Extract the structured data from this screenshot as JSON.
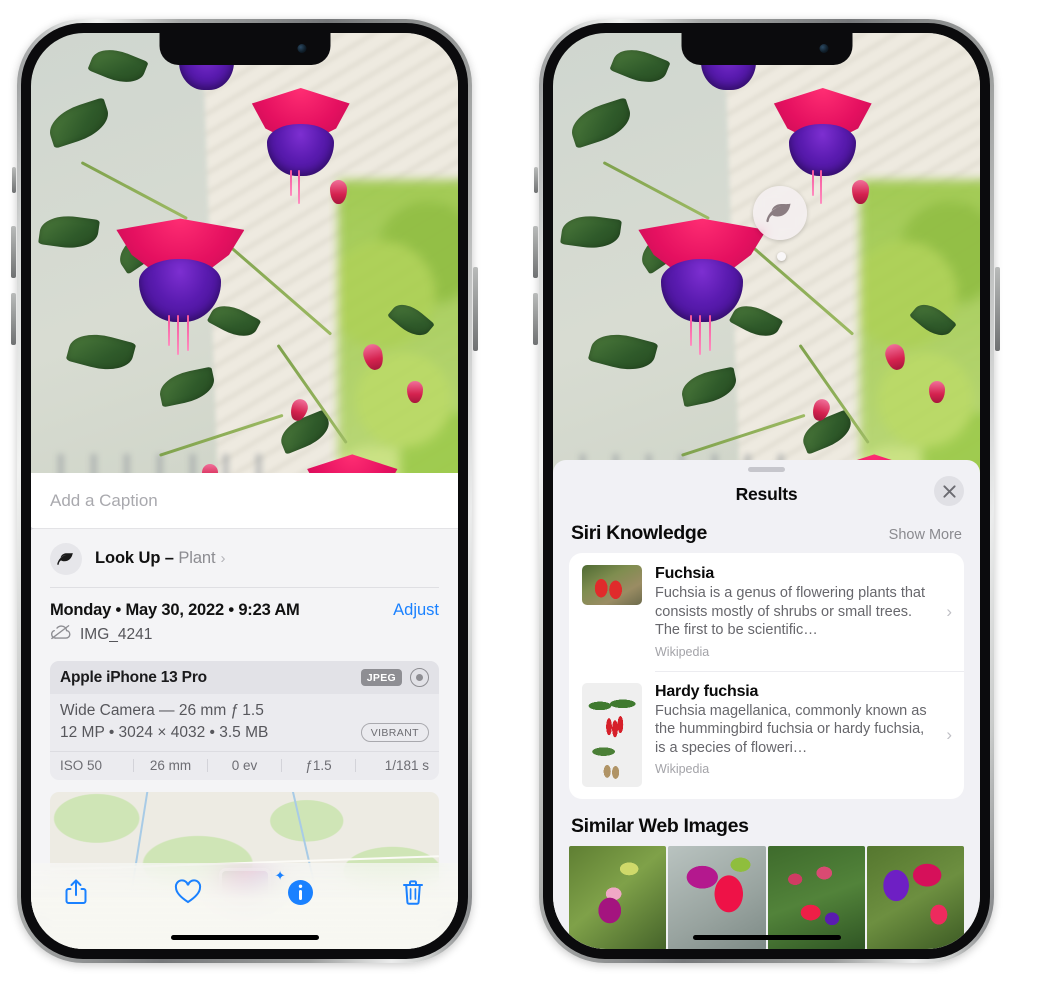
{
  "left_phone": {
    "caption_field": {
      "placeholder": "Add a Caption",
      "value": ""
    },
    "lookup": {
      "label": "Look Up – ",
      "subject": "Plant",
      "chevron": "›",
      "icon": "leaf-icon"
    },
    "metadata": {
      "date": "Monday • May 30, 2022 • 9:23 AM",
      "adjust_label": "Adjust",
      "filename": "IMG_4241",
      "cloud_icon": "cloud-slash-icon"
    },
    "camera_card": {
      "model": "Apple iPhone 13 Pro",
      "format_badge": "JPEG",
      "raw_icon": "raw-circle-icon",
      "lens_line": "Wide Camera — 26 mm ƒ 1.5",
      "size_line": "12 MP • 3024 × 4032 • 3.5 MB",
      "style_badge": "VIBRANT",
      "exif": [
        "ISO 50",
        "26 mm",
        "0 ev",
        "ƒ1.5",
        "1/181 s"
      ]
    },
    "toolbar": {
      "share_label": "share-icon",
      "favorite_label": "heart-icon",
      "info_label": "info-sparkle-icon",
      "delete_label": "trash-icon"
    }
  },
  "right_phone": {
    "visual_lookup_badge": {
      "icon": "leaf-icon"
    },
    "sheet": {
      "title": "Results",
      "close_label": "✕"
    },
    "siri_knowledge": {
      "heading": "Siri Knowledge",
      "show_more": "Show More",
      "items": [
        {
          "title": "Fuchsia",
          "description": "Fuchsia is a genus of flowering plants that consists mostly of shrubs or small trees. The first to be scientific…",
          "source": "Wikipedia",
          "chevron": "›"
        },
        {
          "title": "Hardy fuchsia",
          "description": "Fuchsia magellanica, commonly known as the hummingbird fuchsia or hardy fuchsia, is a species of floweri…",
          "source": "Wikipedia",
          "chevron": "›"
        }
      ]
    },
    "similar_web_images": {
      "heading": "Similar Web Images",
      "count": 4
    }
  },
  "colors": {
    "accent_blue": "#1a81ff",
    "sheet_bg": "#f1f1f5",
    "card_bg": "#ffffff",
    "secondary_text": "#8a8a8f"
  }
}
